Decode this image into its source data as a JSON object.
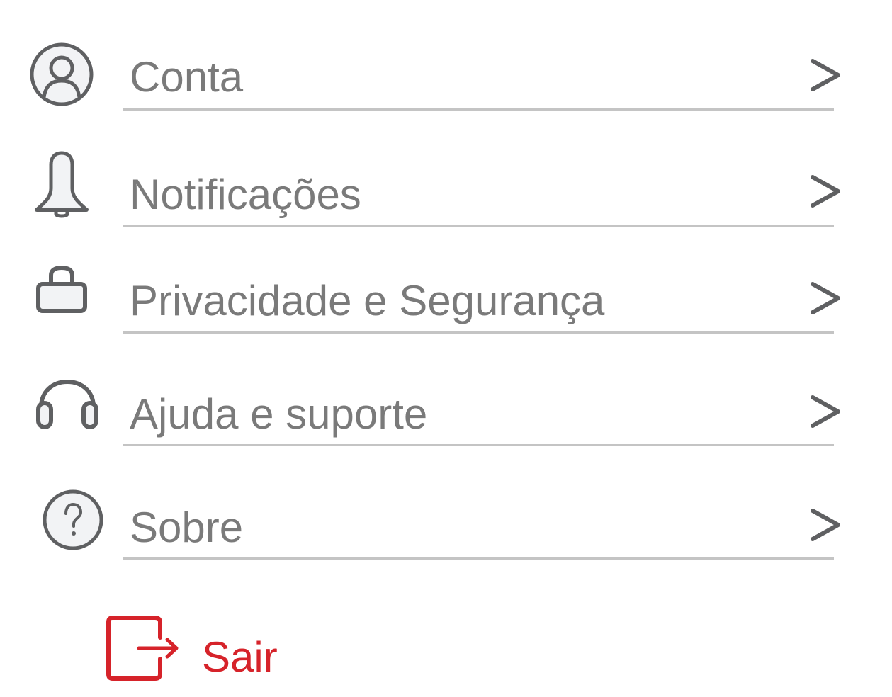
{
  "colors": {
    "text": "#7a7a7a",
    "icon": "#5f6062",
    "icon_fill": "#f2f3f5",
    "divider": "#c4c4c4",
    "danger": "#d6232a"
  },
  "menu": {
    "items": [
      {
        "label": "Conta",
        "icon": "user-circle-icon"
      },
      {
        "label": "Notificações",
        "icon": "bell-icon"
      },
      {
        "label": "Privacidade e Segurança",
        "icon": "lock-icon"
      },
      {
        "label": "Ajuda e suporte",
        "icon": "headphones-icon"
      },
      {
        "label": "Sobre",
        "icon": "help-circle-icon"
      }
    ],
    "chevron_icon": "chevron-right-icon"
  },
  "logout": {
    "label": "Sair",
    "icon": "logout-icon"
  }
}
